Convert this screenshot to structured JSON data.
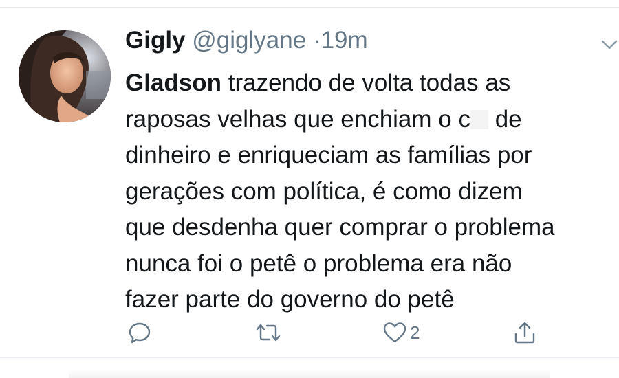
{
  "tweet": {
    "author_name": "Gigly",
    "handle": "@giglyane",
    "separator": "·",
    "time": "19m",
    "mention": "Gladson",
    "lines": [
      " trazendo de volta todas as",
      "raposas velhas que enchiam o c",
      " de",
      "dinheiro e enriqueciam as famílias por",
      "gerações com política, é como dizem",
      "que desdenha quer comprar o problema",
      "nunca foi o petê o problema era não",
      "fazer parte do governo do petê"
    ],
    "like_count": "2"
  },
  "icons": {
    "menu": "chevron-down-icon",
    "reply": "reply-icon",
    "retweet": "retweet-icon",
    "like": "heart-icon",
    "share": "share-icon"
  },
  "colors": {
    "text": "#14171a",
    "secondary": "#657786",
    "divider": "#e6ecf0"
  }
}
